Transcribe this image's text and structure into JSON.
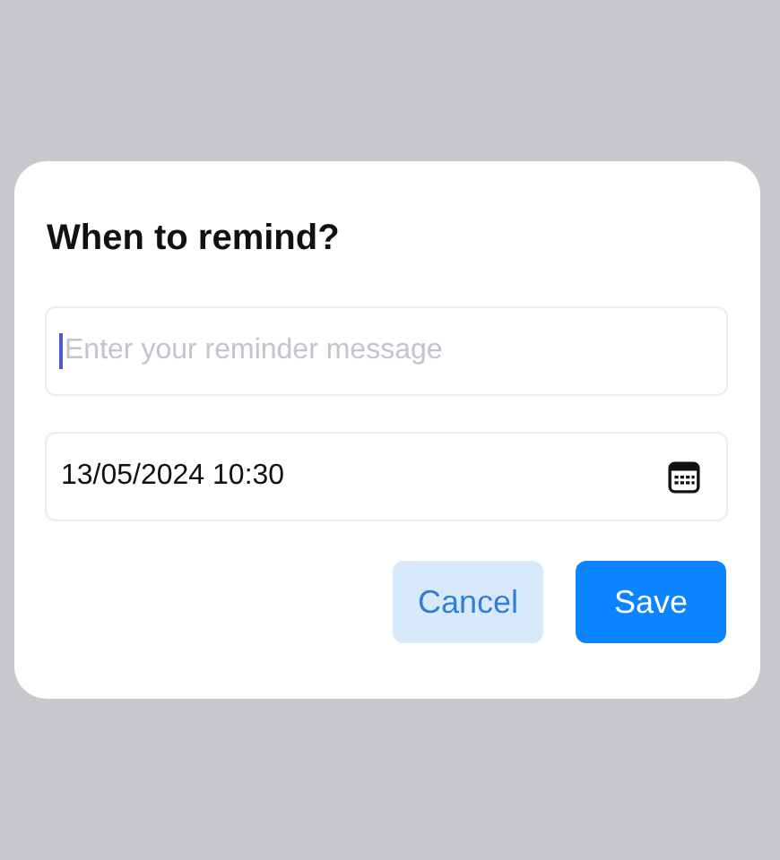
{
  "dialog": {
    "title": "When to remind?",
    "message_field": {
      "placeholder": "Enter your reminder message",
      "focused": true
    },
    "date_field": {
      "value": "13/05/2024 10:30"
    },
    "buttons": [
      {
        "label": "Cancel",
        "kind": "secondary"
      },
      {
        "label": "Save",
        "kind": "primary"
      }
    ]
  }
}
